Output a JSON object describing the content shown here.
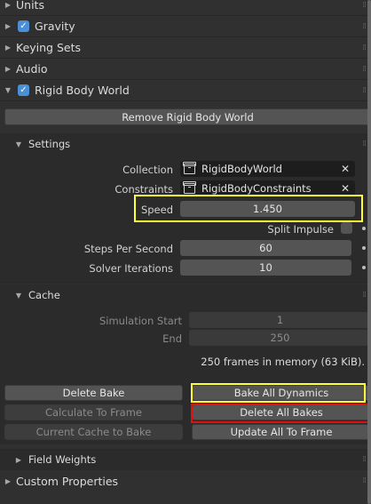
{
  "panels": {
    "units": "Units",
    "gravity": "Gravity",
    "keying_sets": "Keying Sets",
    "audio": "Audio",
    "rigid_body_world": "Rigid Body World",
    "custom_properties": "Custom Properties"
  },
  "remove_button": "Remove Rigid Body World",
  "settings": {
    "header": "Settings",
    "collection_label": "Collection",
    "collection_value": "RigidBodyWorld",
    "constraints_label": "Constraints",
    "constraints_value": "RigidBodyConstraints",
    "speed_label": "Speed",
    "speed_value": "1.450",
    "split_impulse_label": "Split Impulse",
    "steps_label": "Steps Per Second",
    "steps_value": "60",
    "solver_label": "Solver Iterations",
    "solver_value": "10"
  },
  "cache": {
    "header": "Cache",
    "sim_start_label": "Simulation Start",
    "sim_start_value": "1",
    "end_label": "End",
    "end_value": "250",
    "memory_info": "250 frames in memory (63 KiB)."
  },
  "buttons": {
    "delete_bake": "Delete Bake",
    "bake_all_dynamics": "Bake All Dynamics",
    "calculate_to_frame": "Calculate To Frame",
    "delete_all_bakes": "Delete All Bakes",
    "current_cache_to_bake": "Current Cache to Bake",
    "update_all_to_frame": "Update All To Frame"
  },
  "field_weights": "Field Weights",
  "icons": {
    "expand": "triangle-right-icon",
    "collapse": "triangle-down-icon",
    "checkbox": "checkbox-checked-icon",
    "collection": "collection-icon",
    "clear": "x-icon"
  },
  "colors": {
    "highlight_yellow": "#ffff33",
    "highlight_red": "#e01010",
    "checkbox_blue": "#4a90d9"
  }
}
